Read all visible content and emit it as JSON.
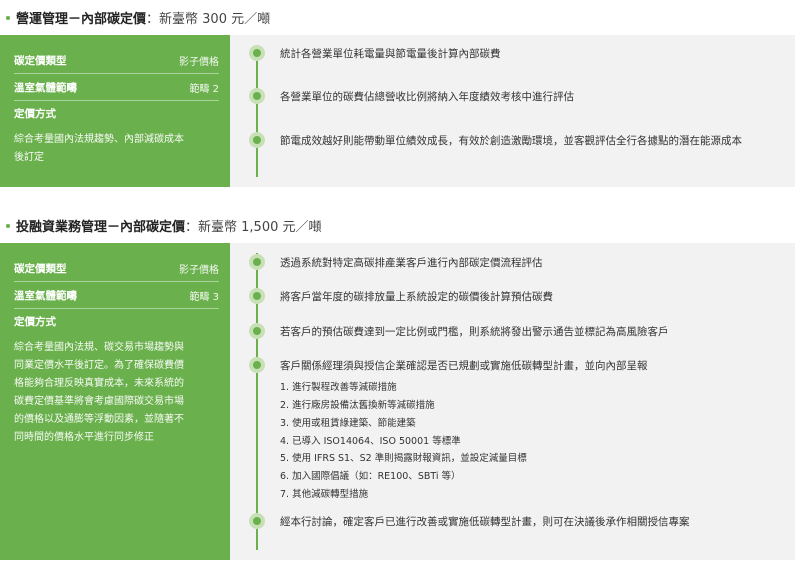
{
  "sections": [
    {
      "title_bold": "營運管理－內部碳定價",
      "title_rest": "：新臺幣 300 元／噸",
      "rows": [
        {
          "key": "碳定價類型",
          "value": "影子價格"
        },
        {
          "key": "溫室氣體範疇",
          "value": "範疇 2"
        },
        {
          "key": "定價方式",
          "value": ""
        }
      ],
      "desc_lines": [
        "綜合考量國內法規趨勢、內部減碳成本",
        "後訂定"
      ],
      "steps": [
        "統計各營業單位耗電量與節電量後計算內部碳費",
        "各營業單位的碳費佔總營收比例將納入年度績效考核中進行評估",
        "節電成效越好則能帶動單位績效成長，有效於創造激勵環境，並客觀評估全行各據點的潛在能源成本"
      ]
    },
    {
      "title_bold": "投融資業務管理－內部碳定價",
      "title_rest": "：新臺幣 1,500 元／噸",
      "rows": [
        {
          "key": "碳定價類型",
          "value": "影子價格"
        },
        {
          "key": "溫室氣體範疇",
          "value": "範疇 3"
        },
        {
          "key": "定價方式",
          "value": ""
        }
      ],
      "desc_lines": [
        "綜合考量國內法規、碳交易市場趨勢與",
        "同業定價水平後訂定。為了確保碳費價",
        "格能夠合理反映真實成本，未來系統的",
        "碳費定價基準將會考慮國際碳交易市場",
        "的價格以及通膨等浮動因素，並隨著不",
        "同時間的價格水平進行同步修正"
      ],
      "steps": [
        "透過系統對特定高碳排產業客戶進行內部碳定價流程評估",
        "將客戶當年度的碳排放量上系統設定的碳價後計算預估碳費",
        "若客戶的預估碳費達到一定比例或門檻，則系統將發出警示通告並標記為高風險客戶",
        "客戶關係經理須與授信企業確認是否已規劃或實施低碳轉型計畫，並向內部呈報",
        "經本行討論，確定客戶已進行改善或實施低碳轉型計畫，則可在決議後承作相關授信專案"
      ],
      "sub_items": [
        "1. 進行製程改善等減碳措施",
        "2. 進行廠房設備汰舊換新等減碳措施",
        "3. 使用或租賃綠建築、節能建築",
        "4. 已導入 ISO14064、ISO 50001 等標準",
        "5. 使用 IFRS S1、S2 準則揭露財報資訊，並設定減量目標",
        "6. 加入國際倡議（如：RE100、SBTi 等）",
        "7. 其他減碳轉型措施"
      ]
    }
  ],
  "colors": {
    "accent": "#6ab04c",
    "node_ring": "#c8e0b6",
    "panel_bg": "#f2f2f2"
  }
}
